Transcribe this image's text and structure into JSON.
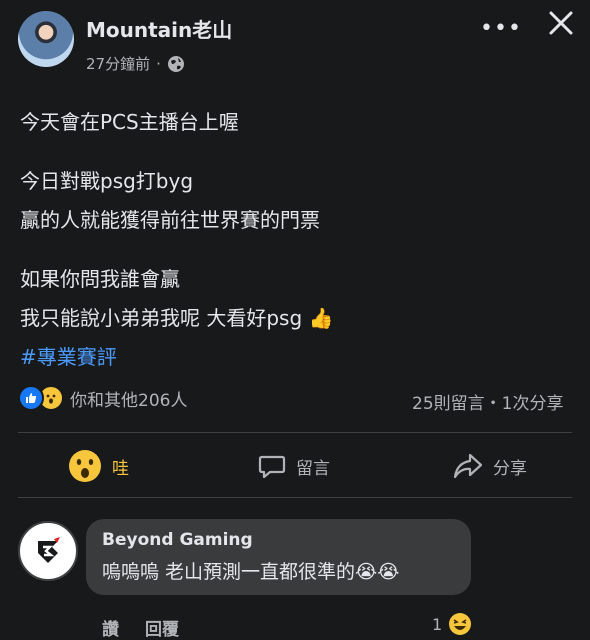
{
  "post": {
    "author": "Mountain老山",
    "time": "27分鐘前",
    "lines": [
      "今天會在PCS主播台上喔",
      "今日對戰psg打byg",
      "贏的人就能獲得前往世界賽的門票",
      "如果你問我誰會贏",
      "我只能說小弟弟我呢 大看好psg"
    ],
    "hashtag": "#專業賽評",
    "reactions_text": "你和其他206人",
    "stats_text": "25則留言・1次分享"
  },
  "actions": {
    "wow": "哇",
    "comment": "留言",
    "share": "分享"
  },
  "comment": {
    "author": "Beyond Gaming",
    "text": "嗚嗚嗚 老山預測一直都很準的",
    "emoji": "😭😭",
    "like_label": "讚",
    "reply_label": "回覆",
    "reaction_count": "1"
  },
  "colors": {
    "background": "#18191a",
    "text": "#e4e6eb",
    "secondary": "#b0b3b8",
    "link": "#4b9bff",
    "bubble": "#3a3b3c"
  }
}
